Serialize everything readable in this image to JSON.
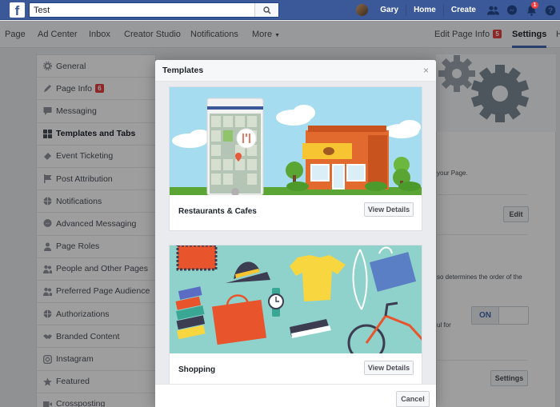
{
  "topbar": {
    "logo": "f",
    "search_value": "Test",
    "user_name": "Gary",
    "home_label": "Home",
    "create_label": "Create",
    "notifications_count": "1"
  },
  "pagenav": {
    "page": "Page",
    "ad_center": "Ad Center",
    "inbox": "Inbox",
    "creator_studio": "Creator Studio",
    "notifications": "Notifications",
    "more": "More",
    "edit_page_info": "Edit Page Info",
    "edit_page_info_badge": "5",
    "settings": "Settings",
    "overflow": "H"
  },
  "sidebar": {
    "items": [
      {
        "label": "General",
        "icon": "gear-icon"
      },
      {
        "label": "Page Info",
        "icon": "pencil-icon",
        "badge": "6"
      },
      {
        "label": "Messaging",
        "icon": "chat-icon"
      },
      {
        "label": "Templates and Tabs",
        "icon": "grid-icon",
        "active": true
      },
      {
        "label": "Event Ticketing",
        "icon": "ticket-icon"
      },
      {
        "label": "Post Attribution",
        "icon": "flag-icon"
      },
      {
        "label": "Notifications",
        "icon": "globe-icon"
      },
      {
        "label": "Advanced Messaging",
        "icon": "messenger-icon"
      },
      {
        "label": "Page Roles",
        "icon": "person-icon"
      },
      {
        "label": "People and Other Pages",
        "icon": "people-icon"
      },
      {
        "label": "Preferred Page Audience",
        "icon": "people-icon"
      },
      {
        "label": "Authorizations",
        "icon": "globe-icon"
      },
      {
        "label": "Branded Content",
        "icon": "handshake-icon"
      },
      {
        "label": "Instagram",
        "icon": "instagram-icon"
      },
      {
        "label": "Featured",
        "icon": "star-icon"
      },
      {
        "label": "Crossposting",
        "icon": "video-icon"
      }
    ]
  },
  "background": {
    "text_page": "your Page.",
    "text_order": "so determines the order of the",
    "text_for": "ul for",
    "edit_label": "Edit",
    "toggle_on": "ON",
    "settings_label": "Settings"
  },
  "dialog": {
    "title": "Templates",
    "close": "×",
    "cards": [
      {
        "title": "Restaurants & Cafes",
        "button": "View Details"
      },
      {
        "title": "Shopping",
        "button": "View Details"
      }
    ],
    "cancel": "Cancel"
  },
  "colors": {
    "brand": "#3b5998",
    "accent": "#4267b2",
    "badge_red": "#e63f3f"
  }
}
